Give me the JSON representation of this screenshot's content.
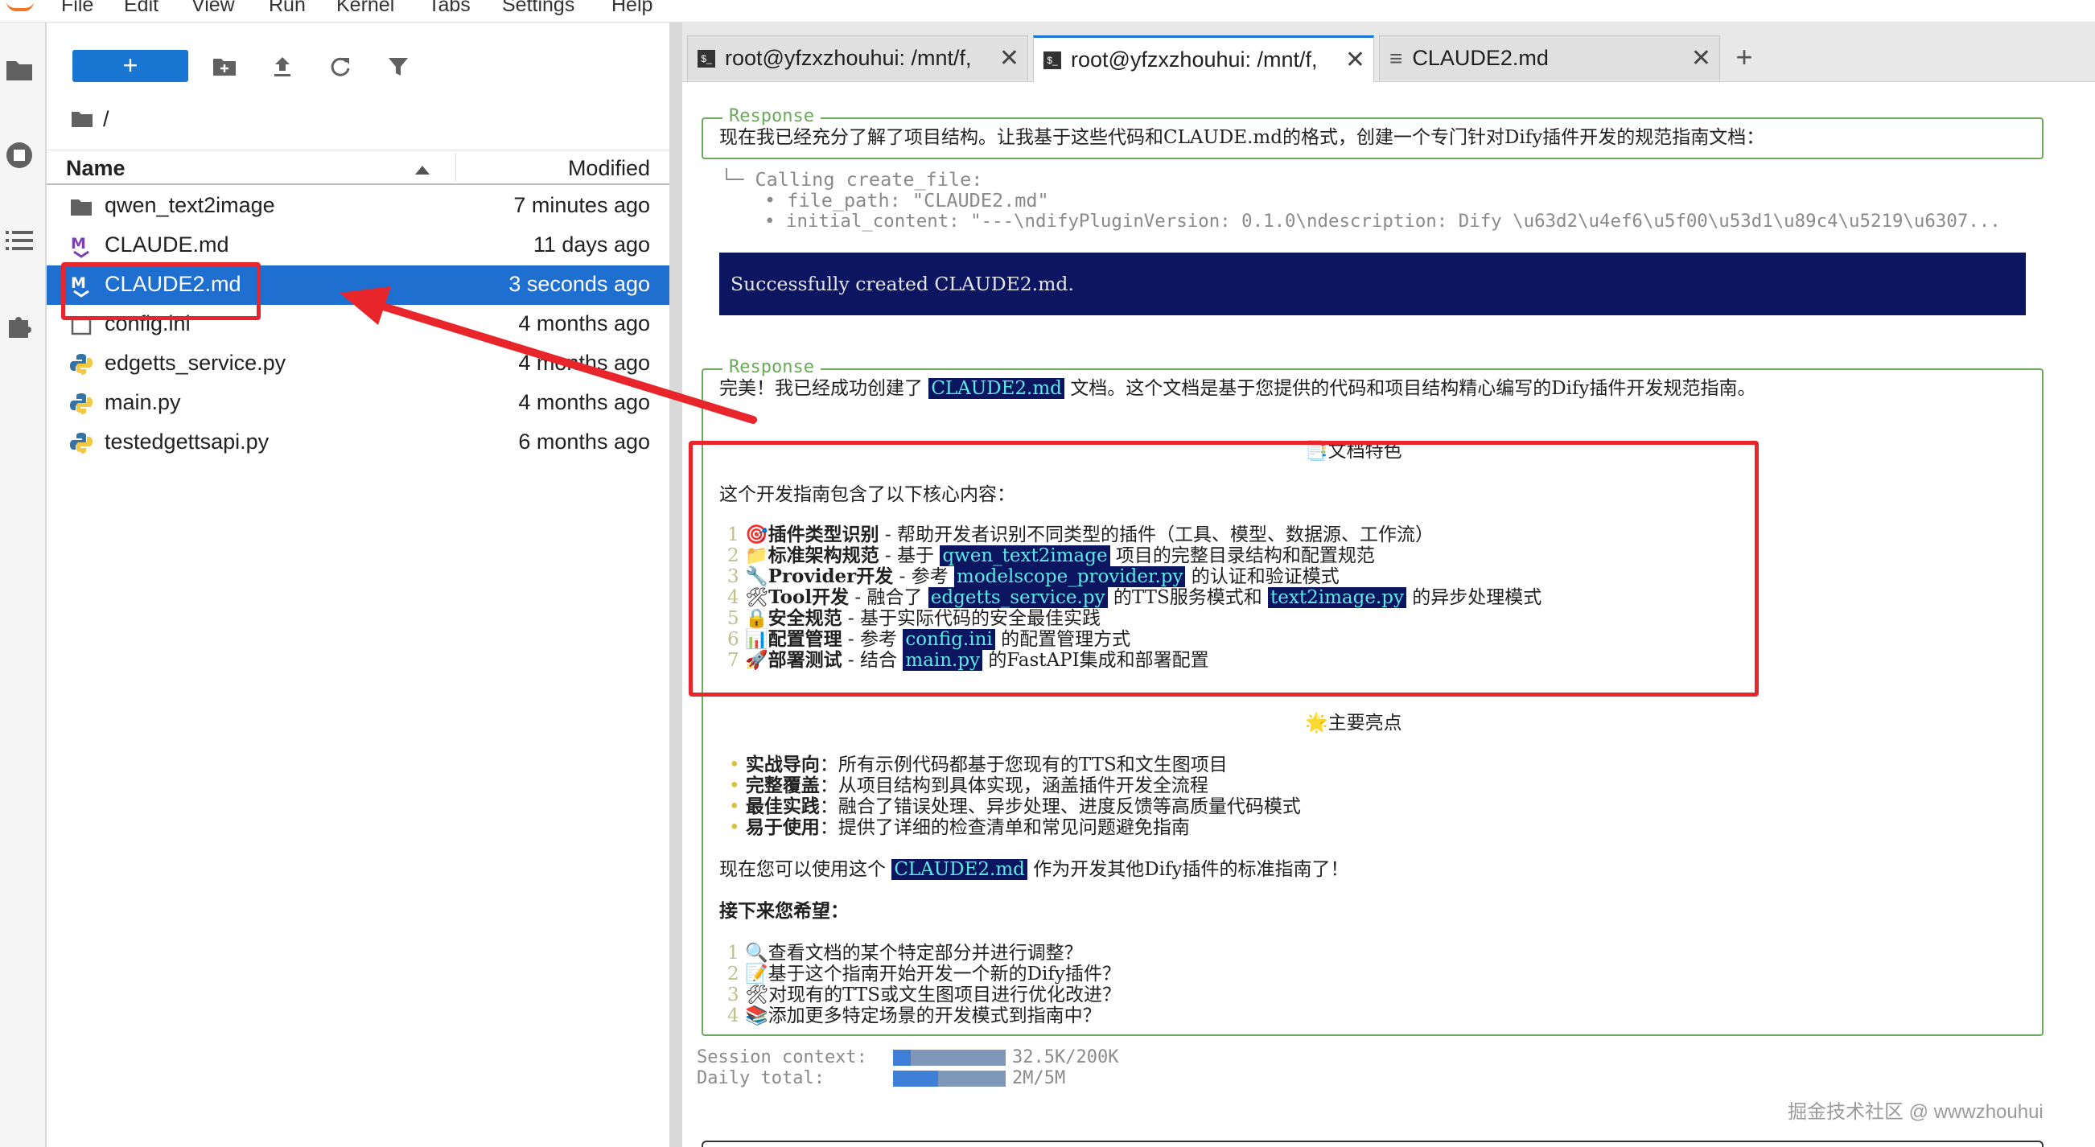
{
  "menubar": {
    "items": [
      "File",
      "Edit",
      "View",
      "Run",
      "Kernel",
      "Tabs",
      "Settings",
      "Help"
    ]
  },
  "activity": {
    "icons": [
      "folder-icon",
      "running-icon",
      "toc-icon",
      "extension-icon"
    ]
  },
  "filebrowser": {
    "new_label": "+",
    "breadcrumb": "/",
    "col_name": "Name",
    "col_modified": "Modified",
    "files": [
      {
        "name": "qwen_text2image",
        "modified": "7 minutes ago",
        "icon": "folder-icon"
      },
      {
        "name": "CLAUDE.md",
        "modified": "11 days ago",
        "icon": "markdown-icon"
      },
      {
        "name": "CLAUDE2.md",
        "modified": "3 seconds ago",
        "icon": "markdown-icon",
        "selected": true
      },
      {
        "name": "config.ini",
        "modified": "4 months ago",
        "icon": "file-icon"
      },
      {
        "name": "edgetts_service.py",
        "modified": "4 months ago",
        "icon": "python-icon"
      },
      {
        "name": "main.py",
        "modified": "4 months ago",
        "icon": "python-icon"
      },
      {
        "name": "testedgettsapi.py",
        "modified": "6 months ago",
        "icon": "python-icon"
      }
    ]
  },
  "tabs": [
    {
      "label": "root@yfzxzhouhui: /mnt/f,",
      "icon": "terminal-icon",
      "active": false
    },
    {
      "label": "root@yfzxzhouhui: /mnt/f,",
      "icon": "terminal-icon",
      "active": true
    },
    {
      "label": "CLAUDE2.md",
      "icon": "markdown-icon",
      "active": false
    }
  ],
  "terminal": {
    "response_label": "Response",
    "resp1": "现在我已经充分了解了项目结构。让我基于这些代码和CLAUDE.md的格式，创建一个专门针对Dify插件开发的规范指南文档：",
    "call_line": "└─ Calling create_file:",
    "call_path": "• file_path: \"CLAUDE2.md\"",
    "call_content": "• initial_content: \"---\\ndifyPluginVersion: 0.1.0\\ndescription: Dify \\u63d2\\u4ef6\\u5f00\\u53d1\\u89c4\\u5219\\u6307...",
    "success": "Successfully created CLAUDE2.md.",
    "resp2_pre": "完美！我已经成功创建了",
    "resp2_code": "CLAUDE2.md",
    "resp2_post": "文档。这个文档是基于您提供的代码和项目结构精心编写的Dify插件开发规范指南。",
    "feature_title": "📑文档特色",
    "feature_intro": "这个开发指南包含了以下核心内容：",
    "features": [
      {
        "n": "1",
        "icon": "🎯",
        "title": "插件类型识别",
        "parts": [
          {
            "t": " - 帮助开发者识别不同类型的插件（工具、模型、数据源、工作流）"
          }
        ]
      },
      {
        "n": "2",
        "icon": "📁",
        "title": "标准架构规范",
        "parts": [
          {
            "t": " - 基于 "
          },
          {
            "c": "qwen_text2image"
          },
          {
            "t": " 项目的完整目录结构和配置规范"
          }
        ]
      },
      {
        "n": "3",
        "icon": "🔧",
        "title": "Provider开发",
        "parts": [
          {
            "t": " - 参考 "
          },
          {
            "c": "modelscope_provider.py"
          },
          {
            "t": " 的认证和验证模式"
          }
        ]
      },
      {
        "n": "4",
        "icon": "🛠",
        "title": "Tool开发",
        "parts": [
          {
            "t": " - 融合了 "
          },
          {
            "c": "edgetts_service.py"
          },
          {
            "t": " 的TTS服务模式和 "
          },
          {
            "c": "text2image.py"
          },
          {
            "t": " 的异步处理模式"
          }
        ]
      },
      {
        "n": "5",
        "icon": "🔒",
        "title": "安全规范",
        "parts": [
          {
            "t": " - 基于实际代码的安全最佳实践"
          }
        ]
      },
      {
        "n": "6",
        "icon": "📊",
        "title": "配置管理",
        "parts": [
          {
            "t": " - 参考 "
          },
          {
            "c": "config.ini"
          },
          {
            "t": " 的配置管理方式"
          }
        ]
      },
      {
        "n": "7",
        "icon": "🚀",
        "title": "部署测试",
        "parts": [
          {
            "t": " - 结合 "
          },
          {
            "c": "main.py"
          },
          {
            "t": " 的FastAPI集成和部署配置"
          }
        ]
      }
    ],
    "highlight_title": "🌟主要亮点",
    "highlights": [
      {
        "b": "实战导向",
        "t": "：所有示例代码都基于您现有的TTS和文生图项目"
      },
      {
        "b": "完整覆盖",
        "t": "：从项目结构到具体实现，涵盖插件开发全流程"
      },
      {
        "b": "最佳实践",
        "t": "：融合了错误处理、异步处理、进度反馈等高质量代码模式"
      },
      {
        "b": "易于使用",
        "t": "：提供了详细的检查清单和常见问题避免指南"
      }
    ],
    "now_pre": "现在您可以使用这个",
    "now_code": "CLAUDE2.md",
    "now_post": "作为开发其他Dify插件的标准指南了！",
    "next_title": "接下来您希望：",
    "next": [
      {
        "n": "1",
        "icon": "🔍",
        "t": "查看文档的某个特定部分并进行调整？"
      },
      {
        "n": "2",
        "icon": "📝",
        "t": "基于这个指南开始开发一个新的Dify插件？"
      },
      {
        "n": "3",
        "icon": "🛠",
        "t": "对现有的TTS或文生图项目进行优化改进？"
      },
      {
        "n": "4",
        "icon": "📚",
        "t": "添加更多特定场景的开发模式到指南中？"
      }
    ],
    "session_label": "Session context:",
    "session_value": "32.5K/200K",
    "session_fill": 0.16,
    "daily_label": "Daily total:",
    "daily_value": "2M/5M",
    "daily_fill": 0.4
  },
  "watermark": "掘金技术社区 @ wwwzhouhui",
  "colors": {
    "accent": "#1976d2",
    "selected": "#1e6fcf",
    "annotation": "#e8252b",
    "success_bg": "#0c1560",
    "code_fg": "#5fe8e6",
    "border_green": "#6aaa5a"
  }
}
